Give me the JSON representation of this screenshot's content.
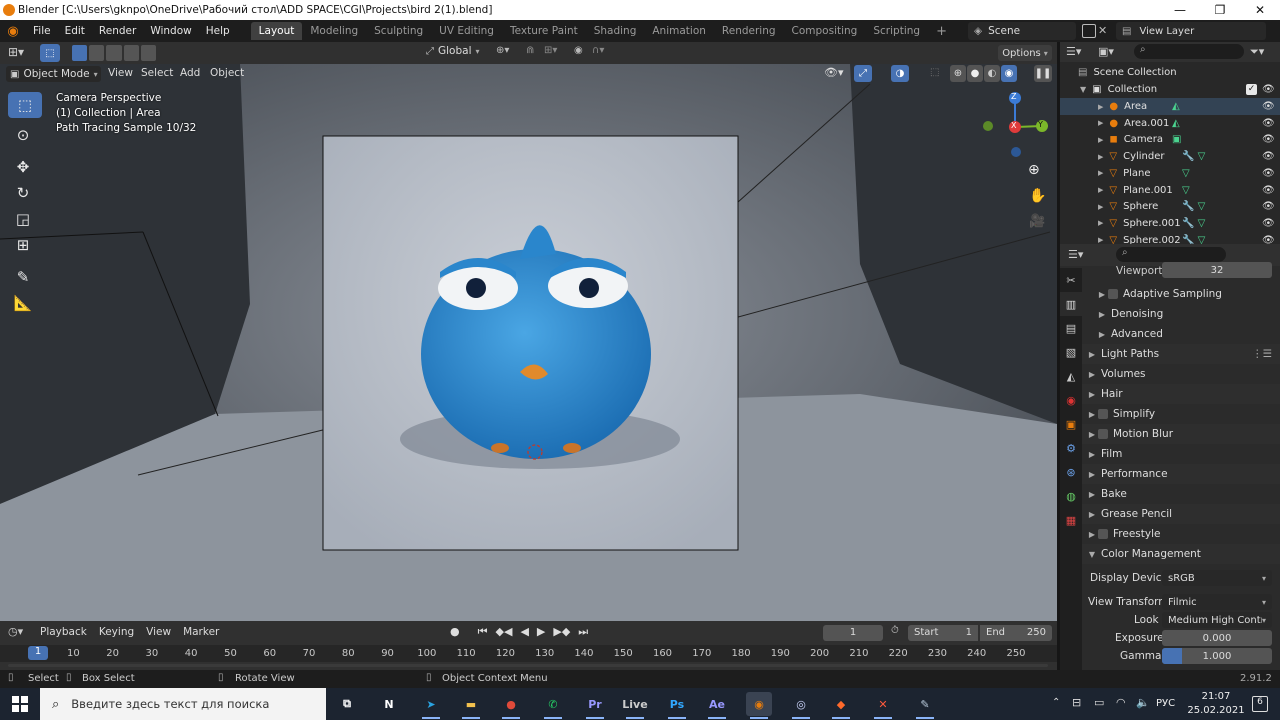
{
  "titlebar": {
    "title": "Blender [C:\\Users\\gknpo\\OneDrive\\Рабочий стол\\ADD SPACE\\CGI\\Projects\\bird 2(1).blend]",
    "minimize": "—",
    "maximize": "❐",
    "close": "✕"
  },
  "menu": [
    "File",
    "Edit",
    "Render",
    "Window",
    "Help"
  ],
  "workspaces": [
    "Layout",
    "Modeling",
    "Sculpting",
    "UV Editing",
    "Texture Paint",
    "Shading",
    "Animation",
    "Rendering",
    "Compositing",
    "Scripting"
  ],
  "active_workspace": "Layout",
  "add_workspace": "+",
  "scene": {
    "name": "Scene",
    "view_layer": "View Layer"
  },
  "viewport_header": {
    "transform_orientation": "Global",
    "options": "Options"
  },
  "viewport_menu": {
    "mode": "Object Mode",
    "items": [
      "View",
      "Select",
      "Add",
      "Object"
    ]
  },
  "hud": {
    "line1": "Camera Perspective",
    "line2": "(1) Collection | Area",
    "line3": "Path Tracing Sample 10/32"
  },
  "gizmo": {
    "z": "Z",
    "y": "Y",
    "x": "X"
  },
  "outliner": {
    "root": "Scene Collection",
    "collection": "Collection",
    "items": [
      {
        "name": "Area",
        "type": "light"
      },
      {
        "name": "Area.001",
        "type": "light"
      },
      {
        "name": "Camera",
        "type": "camera"
      },
      {
        "name": "Cylinder",
        "type": "mesh"
      },
      {
        "name": "Plane",
        "type": "mesh"
      },
      {
        "name": "Plane.001",
        "type": "mesh"
      },
      {
        "name": "Sphere",
        "type": "mesh"
      },
      {
        "name": "Sphere.001",
        "type": "mesh"
      },
      {
        "name": "Sphere.002",
        "type": "mesh"
      }
    ]
  },
  "properties": {
    "viewport_label": "Viewport",
    "viewport_value": "32",
    "sub_sections": [
      "Adaptive Sampling",
      "Denoising",
      "Advanced"
    ],
    "sections": [
      "Light Paths",
      "Volumes",
      "Hair",
      "Simplify",
      "Motion Blur",
      "Film",
      "Performance",
      "Bake",
      "Grease Pencil",
      "Freestyle",
      "Color Management"
    ],
    "color_management": {
      "display_device_label": "Display Device",
      "display_device": "sRGB",
      "view_transform_label": "View Transform",
      "view_transform": "Filmic",
      "look_label": "Look",
      "look": "Medium High Contras",
      "exposure_label": "Exposure",
      "exposure": "0.000",
      "gamma_label": "Gamma",
      "gamma": "1.000"
    }
  },
  "timeline": {
    "menus": [
      "Playback",
      "Keying",
      "View",
      "Marker"
    ],
    "current_frame": "1",
    "start_label": "Start",
    "start": "1",
    "end_label": "End",
    "end": "250",
    "ticks": [
      "1",
      "10",
      "20",
      "30",
      "40",
      "50",
      "60",
      "70",
      "80",
      "90",
      "100",
      "110",
      "120",
      "130",
      "140",
      "150",
      "160",
      "170",
      "180",
      "190",
      "200",
      "210",
      "220",
      "230",
      "240",
      "250"
    ]
  },
  "statusbar": {
    "select": "Select",
    "box_select": "Box Select",
    "rotate_view": "Rotate View",
    "context_menu": "Object Context Menu",
    "version": "2.91.2"
  },
  "taskbar": {
    "search_placeholder": "Введите здесь текст для поиска",
    "apps": [
      {
        "name": "task-view",
        "glyph": "⧉",
        "color": "#ffffff"
      },
      {
        "name": "notion",
        "glyph": "N",
        "color": "#ffffff"
      },
      {
        "name": "telegram",
        "glyph": "➤",
        "color": "#2aa3e0"
      },
      {
        "name": "explorer",
        "glyph": "▬",
        "color": "#f2c14e"
      },
      {
        "name": "chrome",
        "glyph": "●",
        "color": "#e04a3a"
      },
      {
        "name": "whatsapp",
        "glyph": "✆",
        "color": "#25d366"
      },
      {
        "name": "premiere",
        "glyph": "Pr",
        "color": "#9999ff"
      },
      {
        "name": "live",
        "glyph": "Live",
        "color": "#cccccc"
      },
      {
        "name": "photoshop",
        "glyph": "Ps",
        "color": "#31a8ff"
      },
      {
        "name": "after-effects",
        "glyph": "Ae",
        "color": "#9999ff"
      },
      {
        "name": "blender",
        "glyph": "◉",
        "color": "#e87d0d"
      },
      {
        "name": "app-ring",
        "glyph": "◎",
        "color": "#cfd8ff"
      },
      {
        "name": "app-flame",
        "glyph": "◆",
        "color": "#ff6a2b"
      },
      {
        "name": "app-x",
        "glyph": "✕",
        "color": "#ff5a3c"
      },
      {
        "name": "app-feather",
        "glyph": "✎",
        "color": "#bcd"
      }
    ],
    "language": "РУС",
    "time": "21:07",
    "date": "25.02.2021",
    "notifications": "6"
  },
  "colors": {
    "accent": "#4772b3",
    "active_tab": "#404040",
    "blender_orange": "#e87d0d"
  }
}
